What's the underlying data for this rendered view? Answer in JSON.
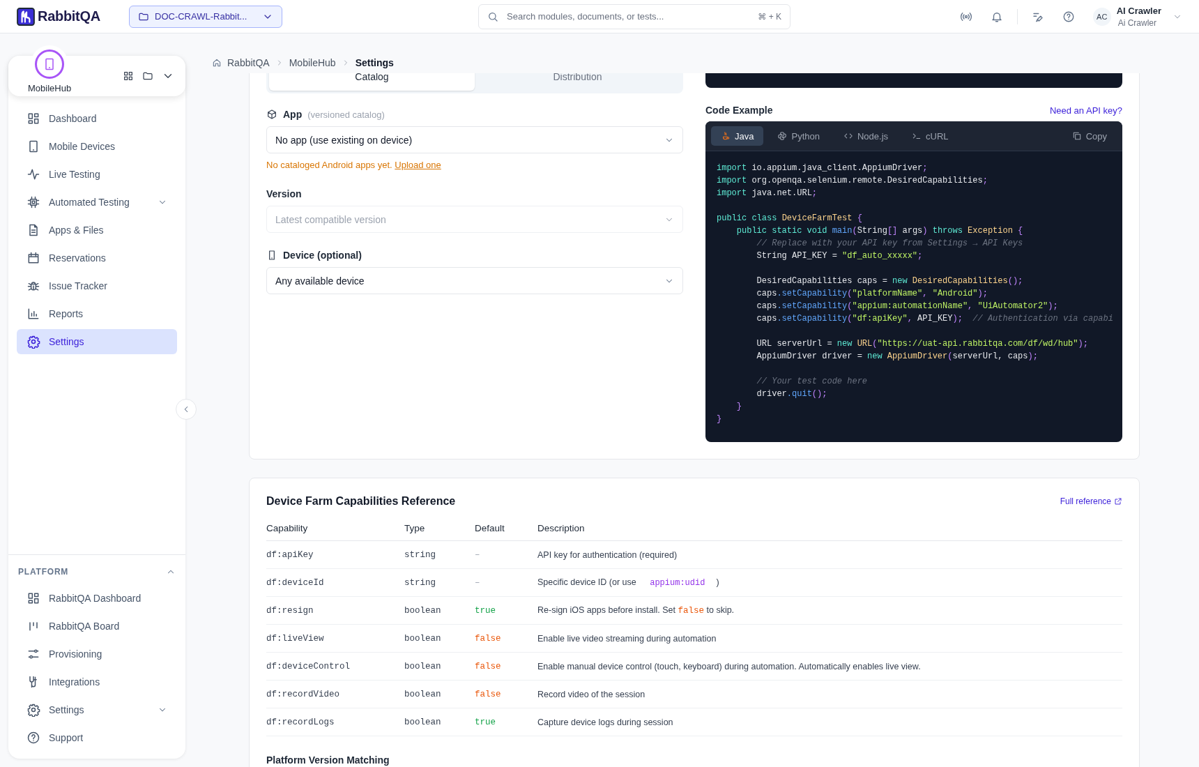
{
  "topbar": {
    "logo": "RabbitQA",
    "project": "DOC-CRAWL-Rabbit...",
    "search_placeholder": "Search modules, documents, or tests...",
    "shortcut": "⌘ + K",
    "avatar": "AC",
    "user_name": "AI Crawler",
    "user_sub": "Ai Crawler"
  },
  "sidebar": {
    "workspace": "MobileHub",
    "items": [
      {
        "label": "Dashboard",
        "selected": false,
        "expandable": false
      },
      {
        "label": "Mobile Devices",
        "selected": false,
        "expandable": false
      },
      {
        "label": "Live Testing",
        "selected": false,
        "expandable": false
      },
      {
        "label": "Automated Testing",
        "selected": false,
        "expandable": true
      },
      {
        "label": "Apps & Files",
        "selected": false,
        "expandable": false
      },
      {
        "label": "Reservations",
        "selected": false,
        "expandable": false
      },
      {
        "label": "Issue Tracker",
        "selected": false,
        "expandable": false
      },
      {
        "label": "Reports",
        "selected": false,
        "expandable": false
      },
      {
        "label": "Settings",
        "selected": true,
        "expandable": false
      }
    ],
    "platform_title": "PLATFORM",
    "platform_items": [
      {
        "label": "RabbitQA Dashboard",
        "expandable": false
      },
      {
        "label": "RabbitQA Board",
        "expandable": false
      },
      {
        "label": "Provisioning",
        "expandable": false
      },
      {
        "label": "Integrations",
        "expandable": false
      },
      {
        "label": "Settings",
        "expandable": true
      },
      {
        "label": "Support",
        "expandable": false
      }
    ]
  },
  "breadcrumb": [
    "RabbitQA",
    "MobileHub",
    "Settings"
  ],
  "form": {
    "tabs": [
      {
        "label": "Catalog",
        "selected": true
      },
      {
        "label": "Distribution",
        "selected": false
      }
    ],
    "app_label": "App",
    "app_hint": "(versioned catalog)",
    "app_value": "No app (use existing on device)",
    "warning": "No cataloged Android apps yet.",
    "warning_link": "Upload one",
    "version_label": "Version",
    "version_placeholder": "Latest compatible version",
    "device_label": "Device (optional)",
    "device_value": "Any available device"
  },
  "code": {
    "title": "Code Example",
    "link": "Need an API key?",
    "copy": "Copy",
    "tabs": [
      {
        "label": "Java",
        "selected": true
      },
      {
        "label": "Python",
        "selected": false
      },
      {
        "label": "Node.js",
        "selected": false
      },
      {
        "label": "cURL",
        "selected": false
      }
    ],
    "blocks": [
      [
        [
          {
            "text": "import",
            "kind": "kw"
          },
          {
            "text": " io.appium.java_client.AppiumDriver",
            "kind": "p"
          },
          {
            "text": ";",
            "kind": "pu"
          }
        ],
        [
          {
            "text": "import",
            "kind": "kw"
          },
          {
            "text": " org.openqa.selenium.remote.DesiredCapabilities",
            "kind": "p"
          },
          {
            "text": ";",
            "kind": "pu"
          }
        ],
        [
          {
            "text": "import",
            "kind": "kw"
          },
          {
            "text": " java.net.URL",
            "kind": "p"
          },
          {
            "text": ";",
            "kind": "pu"
          }
        ]
      ],
      [
        [
          {
            "text": "public class ",
            "kind": "kw"
          },
          {
            "text": "DeviceFarmTest",
            "kind": "ty"
          },
          {
            "text": " {",
            "kind": "pu"
          }
        ],
        [
          {
            "text": "    public static void ",
            "kind": "kw"
          },
          {
            "text": "main",
            "kind": "fn"
          },
          {
            "text": "(",
            "kind": "pu"
          },
          {
            "text": "String",
            "kind": "p"
          },
          {
            "text": "[]",
            "kind": "pu"
          },
          {
            "text": " args",
            "kind": "p"
          },
          {
            "text": ")",
            "kind": "pu"
          },
          {
            "text": " throws ",
            "kind": "kw"
          },
          {
            "text": "Exception",
            "kind": "ty"
          },
          {
            "text": " {",
            "kind": "pu"
          }
        ],
        [
          {
            "text": "        // Replace with your API key from Settings → API Keys",
            "kind": "cm"
          }
        ],
        [
          {
            "text": "        String API_KEY = ",
            "kind": "p"
          },
          {
            "text": "\"df_auto_xxxxx\"",
            "kind": "st"
          },
          {
            "text": ";",
            "kind": "pu"
          }
        ]
      ],
      [
        [
          {
            "text": "        DesiredCapabilities caps = ",
            "kind": "p"
          },
          {
            "text": "new ",
            "kind": "kw"
          },
          {
            "text": "DesiredCapabilities",
            "kind": "ty"
          },
          {
            "text": "();",
            "kind": "pu"
          }
        ],
        [
          {
            "text": "        caps",
            "kind": "p"
          },
          {
            "text": ".setCapability",
            "kind": "fn"
          },
          {
            "text": "(",
            "kind": "pu"
          },
          {
            "text": "\"platformName\"",
            "kind": "st"
          },
          {
            "text": ", ",
            "kind": "pu"
          },
          {
            "text": "\"Android\"",
            "kind": "st"
          },
          {
            "text": ");",
            "kind": "pu"
          }
        ],
        [
          {
            "text": "        caps",
            "kind": "p"
          },
          {
            "text": ".setCapability",
            "kind": "fn"
          },
          {
            "text": "(",
            "kind": "pu"
          },
          {
            "text": "\"appium:automationName\"",
            "kind": "st"
          },
          {
            "text": ", ",
            "kind": "pu"
          },
          {
            "text": "\"UiAutomator2\"",
            "kind": "st"
          },
          {
            "text": ");",
            "kind": "pu"
          }
        ],
        [
          {
            "text": "        caps",
            "kind": "p"
          },
          {
            "text": ".setCapability",
            "kind": "fn"
          },
          {
            "text": "(",
            "kind": "pu"
          },
          {
            "text": "\"df:apiKey\"",
            "kind": "st"
          },
          {
            "text": ", ",
            "kind": "pu"
          },
          {
            "text": "API_KEY",
            "kind": "p"
          },
          {
            "text": ");",
            "kind": "pu"
          },
          {
            "text": "  // Authentication via capabi",
            "kind": "cm"
          }
        ]
      ],
      [
        [
          {
            "text": "        URL serverUrl = ",
            "kind": "p"
          },
          {
            "text": "new ",
            "kind": "kw"
          },
          {
            "text": "URL",
            "kind": "ty"
          },
          {
            "text": "(",
            "kind": "pu"
          },
          {
            "text": "\"https://uat-api.rabbitqa.com/df/wd/hub\"",
            "kind": "st"
          },
          {
            "text": ");",
            "kind": "pu"
          }
        ],
        [
          {
            "text": "        AppiumDriver driver = ",
            "kind": "p"
          },
          {
            "text": "new ",
            "kind": "kw"
          },
          {
            "text": "AppiumDriver",
            "kind": "ty"
          },
          {
            "text": "(",
            "kind": "pu"
          },
          {
            "text": "serverUrl, caps",
            "kind": "p"
          },
          {
            "text": ");",
            "kind": "pu"
          }
        ]
      ],
      [
        [
          {
            "text": "        // Your test code here",
            "kind": "cm"
          }
        ],
        [
          {
            "text": "        driver",
            "kind": "p"
          },
          {
            "text": ".quit",
            "kind": "fn"
          },
          {
            "text": "();",
            "kind": "pu"
          }
        ],
        [
          {
            "text": "    }",
            "kind": "pu"
          }
        ],
        [
          {
            "text": "}",
            "kind": "pu"
          }
        ]
      ]
    ]
  },
  "reference": {
    "title": "Device Farm Capabilities Reference",
    "link": "Full reference",
    "columns": [
      "Capability",
      "Type",
      "Default",
      "Description"
    ],
    "rows": [
      {
        "capability": "df:apiKey",
        "type": "string",
        "default": {
          "text": "–",
          "kind": "none"
        },
        "description": [
          {
            "text": "API key for authentication (required)",
            "kind": "text"
          }
        ]
      },
      {
        "capability": "df:deviceId",
        "type": "string",
        "default": {
          "text": "–",
          "kind": "none"
        },
        "description": [
          {
            "text": "Specific device ID (or use ",
            "kind": "text"
          },
          {
            "text": "appium:udid",
            "kind": "code"
          },
          {
            "text": ")",
            "kind": "text"
          }
        ]
      },
      {
        "capability": "df:resign",
        "type": "boolean",
        "default": {
          "text": "true",
          "kind": "true"
        },
        "description": [
          {
            "text": "Re-sign iOS apps before install. Set ",
            "kind": "text"
          },
          {
            "text": "false",
            "kind": "false"
          },
          {
            "text": " to skip.",
            "kind": "text"
          }
        ]
      },
      {
        "capability": "df:liveView",
        "type": "boolean",
        "default": {
          "text": "false",
          "kind": "false"
        },
        "description": [
          {
            "text": "Enable live video streaming during automation",
            "kind": "text"
          }
        ]
      },
      {
        "capability": "df:deviceControl",
        "type": "boolean",
        "default": {
          "text": "false",
          "kind": "false"
        },
        "description": [
          {
            "text": "Enable manual device control (touch, keyboard) during automation. Automatically enables live view.",
            "kind": "text"
          }
        ]
      },
      {
        "capability": "df:recordVideo",
        "type": "boolean",
        "default": {
          "text": "false",
          "kind": "false"
        },
        "description": [
          {
            "text": "Record video of the session",
            "kind": "text"
          }
        ]
      },
      {
        "capability": "df:recordLogs",
        "type": "boolean",
        "default": {
          "text": "true",
          "kind": "true"
        },
        "description": [
          {
            "text": "Capture device logs during session",
            "kind": "text"
          }
        ]
      }
    ],
    "next_title": "Platform Version Matching"
  }
}
